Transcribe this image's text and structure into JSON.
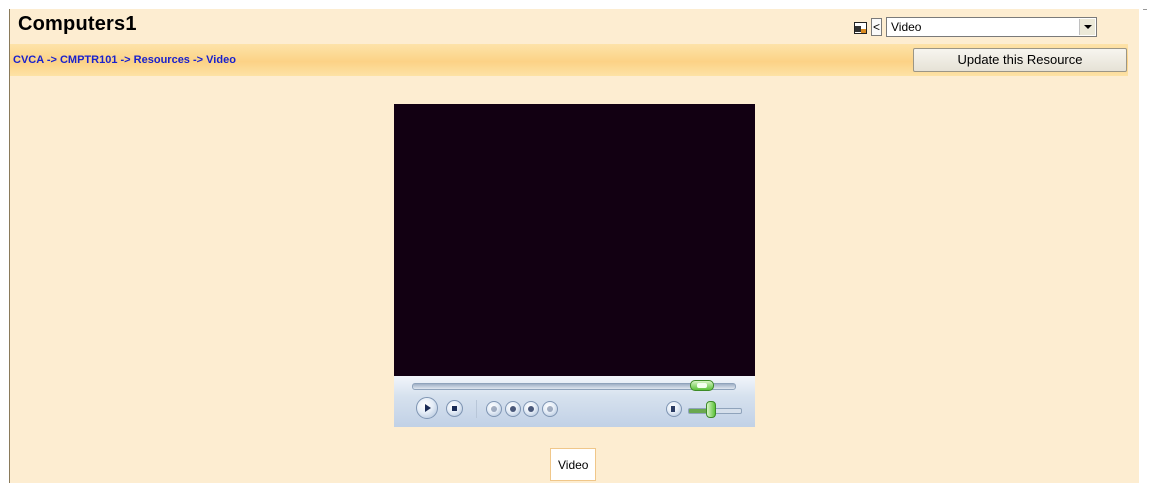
{
  "course": {
    "title": "Computers1"
  },
  "jump_menu": {
    "prev_label": "<",
    "selected": "Video"
  },
  "breadcrumb": {
    "items": [
      "CVCA",
      "CMPTR101",
      "Resources",
      "Video"
    ],
    "separator": "->"
  },
  "update_button": {
    "label": "Update this Resource"
  },
  "player": {
    "icons": [
      "play-icon",
      "stop-icon",
      "previous-track-icon",
      "rewind-icon",
      "fast-forward-icon",
      "next-track-icon",
      "volume-icon"
    ],
    "seek_position": 0.91,
    "volume_level": 0.45
  },
  "resource": {
    "caption": "Video"
  },
  "colors": {
    "page_background": "#fdedd1",
    "navbar": "#fcd286",
    "link": "#1a22cc",
    "video_screen": "#120012"
  }
}
